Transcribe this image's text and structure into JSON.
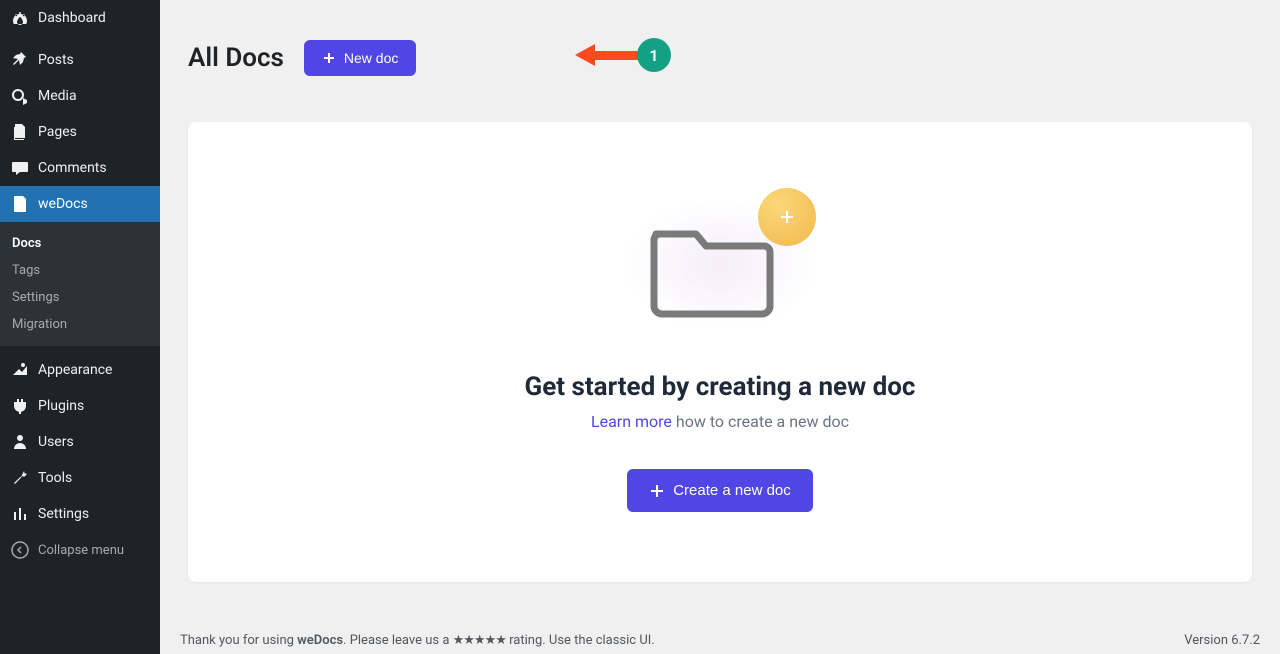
{
  "sidebar": {
    "items": [
      {
        "label": "Dashboard",
        "icon": "dashboard-icon"
      },
      {
        "label": "Posts",
        "icon": "pin-icon"
      },
      {
        "label": "Media",
        "icon": "media-icon"
      },
      {
        "label": "Pages",
        "icon": "pages-icon"
      },
      {
        "label": "Comments",
        "icon": "comments-icon"
      },
      {
        "label": "weDocs",
        "icon": "wedocs-icon"
      },
      {
        "label": "Appearance",
        "icon": "appearance-icon"
      },
      {
        "label": "Plugins",
        "icon": "plugins-icon"
      },
      {
        "label": "Users",
        "icon": "users-icon"
      },
      {
        "label": "Tools",
        "icon": "tools-icon"
      },
      {
        "label": "Settings",
        "icon": "settings-icon"
      }
    ],
    "submenu": [
      "Docs",
      "Tags",
      "Settings",
      "Migration"
    ],
    "collapse": "Collapse menu"
  },
  "header": {
    "title": "All Docs",
    "new_doc": "New doc"
  },
  "empty": {
    "headline": "Get started by creating a new doc",
    "learn_more": "Learn more",
    "sub_rest": " how to create a new doc",
    "cta": "Create a new doc"
  },
  "annotation": {
    "number": "1"
  },
  "footer": {
    "thanks_prefix": "Thank you for using ",
    "brand": "weDocs",
    "thanks_mid": ". Please leave us a ",
    "thanks_suffix": " rating. Use the classic UI.",
    "version": "Version 6.7.2"
  }
}
